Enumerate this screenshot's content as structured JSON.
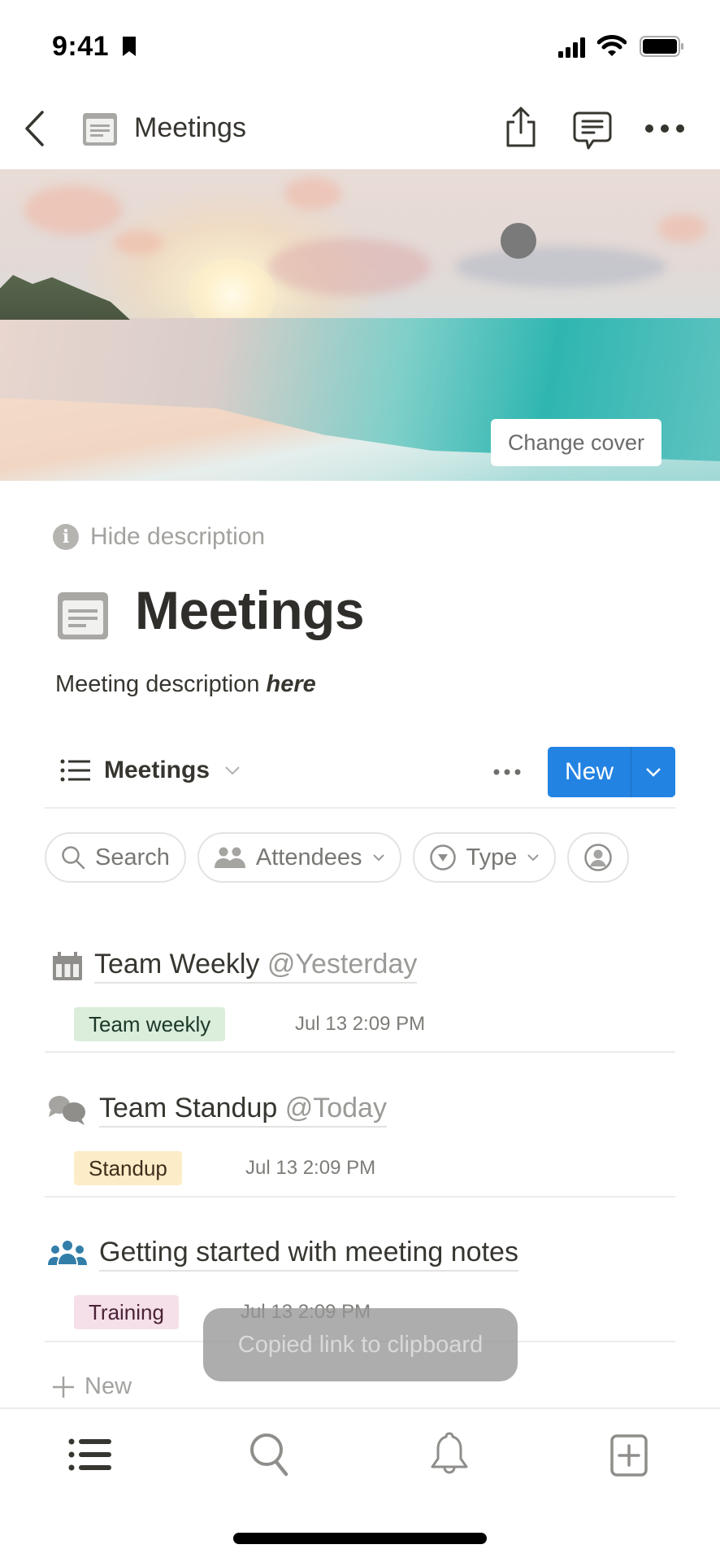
{
  "status_bar": {
    "time": "9:41"
  },
  "nav": {
    "title": "Meetings"
  },
  "cover": {
    "change_cover_label": "Change cover"
  },
  "page": {
    "hide_description_label": "Hide description",
    "title": "Meetings",
    "description_plain": "Meeting description ",
    "description_emphasis": "here"
  },
  "database": {
    "view_name": "Meetings",
    "new_label": "New",
    "filters": [
      {
        "label": "Search",
        "icon": "search-icon"
      },
      {
        "label": "Attendees",
        "icon": "people-icon"
      },
      {
        "label": "Type",
        "icon": "select-icon"
      },
      {
        "label": "",
        "icon": "person-icon"
      }
    ],
    "rows": [
      {
        "icon": "calendar-icon",
        "title": "Team Weekly",
        "mention": "@Yesterday",
        "tag": "Team weekly",
        "tag_color": "#dbeddb",
        "date": "Jul 13 2:09 PM"
      },
      {
        "icon": "chat-bubbles-icon",
        "title": "Team Standup",
        "mention": "@Today",
        "tag": "Standup",
        "tag_color": "#fdecc8",
        "date": "Jul 13 2:09 PM"
      },
      {
        "icon": "group-icon",
        "title": "Getting started with meeting notes",
        "mention": "",
        "tag": "Training",
        "tag_color": "#f5e0e9",
        "date": "Jul 13 2:09 PM"
      }
    ],
    "add_new_label": "New"
  },
  "toast": {
    "message": "Copied link to clipboard"
  },
  "colors": {
    "accent": "#2383e2",
    "group_icon": "#337ea9"
  }
}
